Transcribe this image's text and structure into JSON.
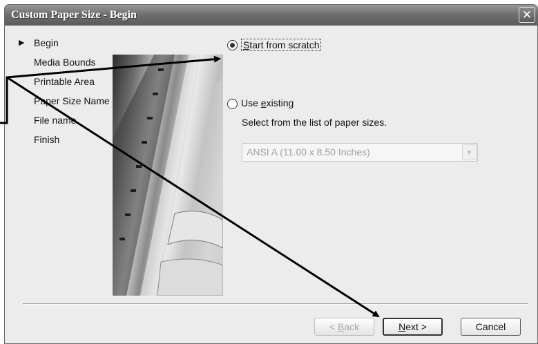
{
  "window": {
    "title": "Custom Paper Size - Begin",
    "close_label": "✕"
  },
  "steps": [
    {
      "label": "Begin",
      "current": true
    },
    {
      "label": "Media Bounds"
    },
    {
      "label": "Printable Area"
    },
    {
      "label": "Paper Size Name"
    },
    {
      "label": "File name"
    },
    {
      "label": "Finish"
    }
  ],
  "options": {
    "start_from_scratch": {
      "prefix": "",
      "mnemonic": "S",
      "rest": "tart from scratch",
      "selected": true
    },
    "use_existing": {
      "prefix": "Use ",
      "mnemonic": "e",
      "rest": "xisting",
      "selected": false
    },
    "hint": "Select from the list of paper sizes.",
    "paper_size_select": {
      "value": "ANSI A (11.00 x 8.50 Inches)",
      "enabled": false
    }
  },
  "buttons": {
    "back": {
      "prefix": "< ",
      "mnemonic": "B",
      "rest": "ack",
      "enabled": false
    },
    "next": {
      "prefix": "",
      "mnemonic": "N",
      "rest": "ext >"
    },
    "cancel": {
      "label": "Cancel"
    }
  },
  "marker_glyph": "▶",
  "dropdown_glyph": "▾"
}
